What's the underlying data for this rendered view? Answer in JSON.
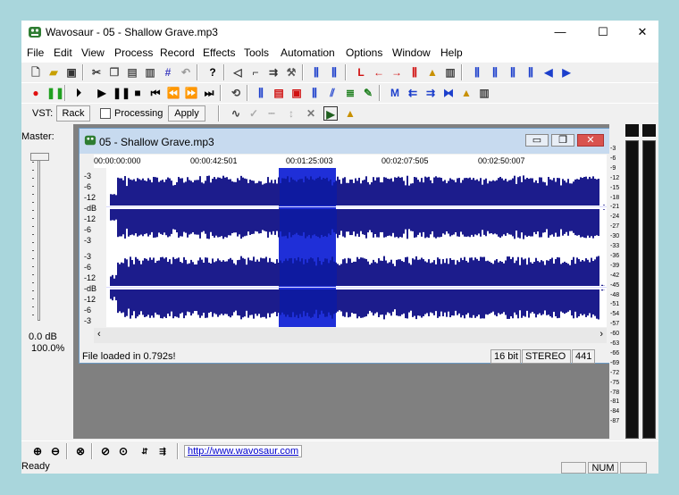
{
  "window": {
    "title": "Wavosaur - 05 - Shallow Grave.mp3",
    "minimize": "—",
    "maximize": "☐",
    "close": "✕"
  },
  "menu": [
    "File",
    "Edit",
    "View",
    "Process",
    "Record",
    "Effects",
    "Tools",
    "Automation",
    "Options",
    "Window",
    "Help"
  ],
  "vst_bar": {
    "vst_label": "VST:",
    "rack_button": "Rack",
    "processing_label": "Processing",
    "processing_checked": false,
    "apply_button": "Apply"
  },
  "master": {
    "label": "Master:",
    "db": "0.0 dB",
    "percent": "100.0%",
    "level": 1.0
  },
  "document": {
    "title": "05 - Shallow Grave.mp3",
    "timeline": [
      "00:00:00:000",
      "00:00:42:501",
      "00:01:25:003",
      "00:02:07:505",
      "00:02:50:007"
    ],
    "db_scale": [
      "-3",
      "-6",
      "-12",
      "-dB",
      "-12",
      "-6",
      "-3"
    ],
    "status": "File loaded in 0.792s!",
    "bits": "16 bit",
    "channels": "STEREO",
    "rate": "441"
  },
  "vu_scale": [
    "-3",
    "-6",
    "-9",
    "-12",
    "-15",
    "-18",
    "-21",
    "-24",
    "-27",
    "-30",
    "-33",
    "-36",
    "-39",
    "-42",
    "-45",
    "-48",
    "-51",
    "-54",
    "-57",
    "-60",
    "-63",
    "-66",
    "-69",
    "-72",
    "-75",
    "-78",
    "-81",
    "-84",
    "-87"
  ],
  "url": "http://www.wavosaur.com",
  "statusbar": {
    "ready": "Ready",
    "num": "NUM"
  },
  "colors": {
    "wave": "#1c1c8c",
    "selection": "#1f2fd8",
    "background": "#a9d6dc"
  }
}
